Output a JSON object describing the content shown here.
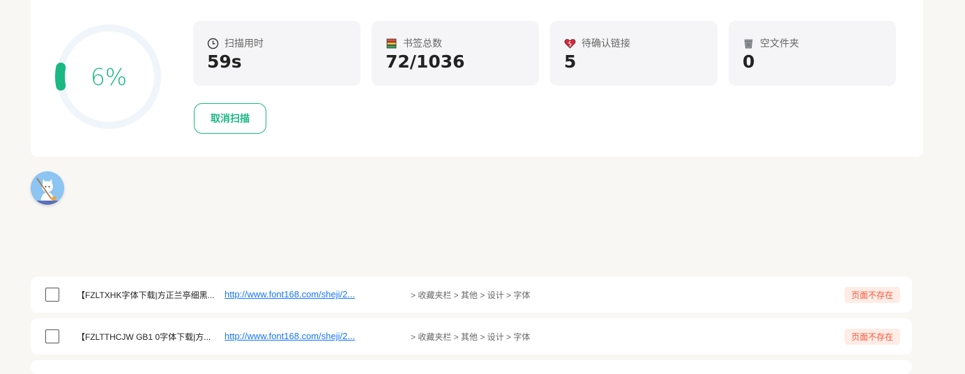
{
  "progress": {
    "percent": 0.06,
    "label": "6%",
    "color": "#1ab882",
    "track_color": "#f0f5fc"
  },
  "stats": [
    {
      "icon": "clock-icon",
      "label": "扫描用时",
      "value": "59s"
    },
    {
      "icon": "books-icon",
      "label": "书签总数",
      "value": "72/1036"
    },
    {
      "icon": "broken-heart-icon",
      "label": "待确认链接",
      "value": "5"
    },
    {
      "icon": "trash-icon",
      "label": "空文件夹",
      "value": "0"
    }
  ],
  "cancel_label": "取消扫描",
  "rows": [
    {
      "title": "【FZLTXHK字体下载|方正兰亭细黑...",
      "url": "http://www.font168.com/sheji/2...",
      "path": "> 收藏夹栏 > 其他 > 设计 > 字体",
      "status": "页面不存在"
    },
    {
      "title": "【FZLTTHCJW GB1 0字体下载|方...",
      "url": "http://www.font168.com/sheji/2...",
      "path": "> 收藏夹栏 > 其他 > 设计 > 字体",
      "status": "页面不存在"
    }
  ]
}
